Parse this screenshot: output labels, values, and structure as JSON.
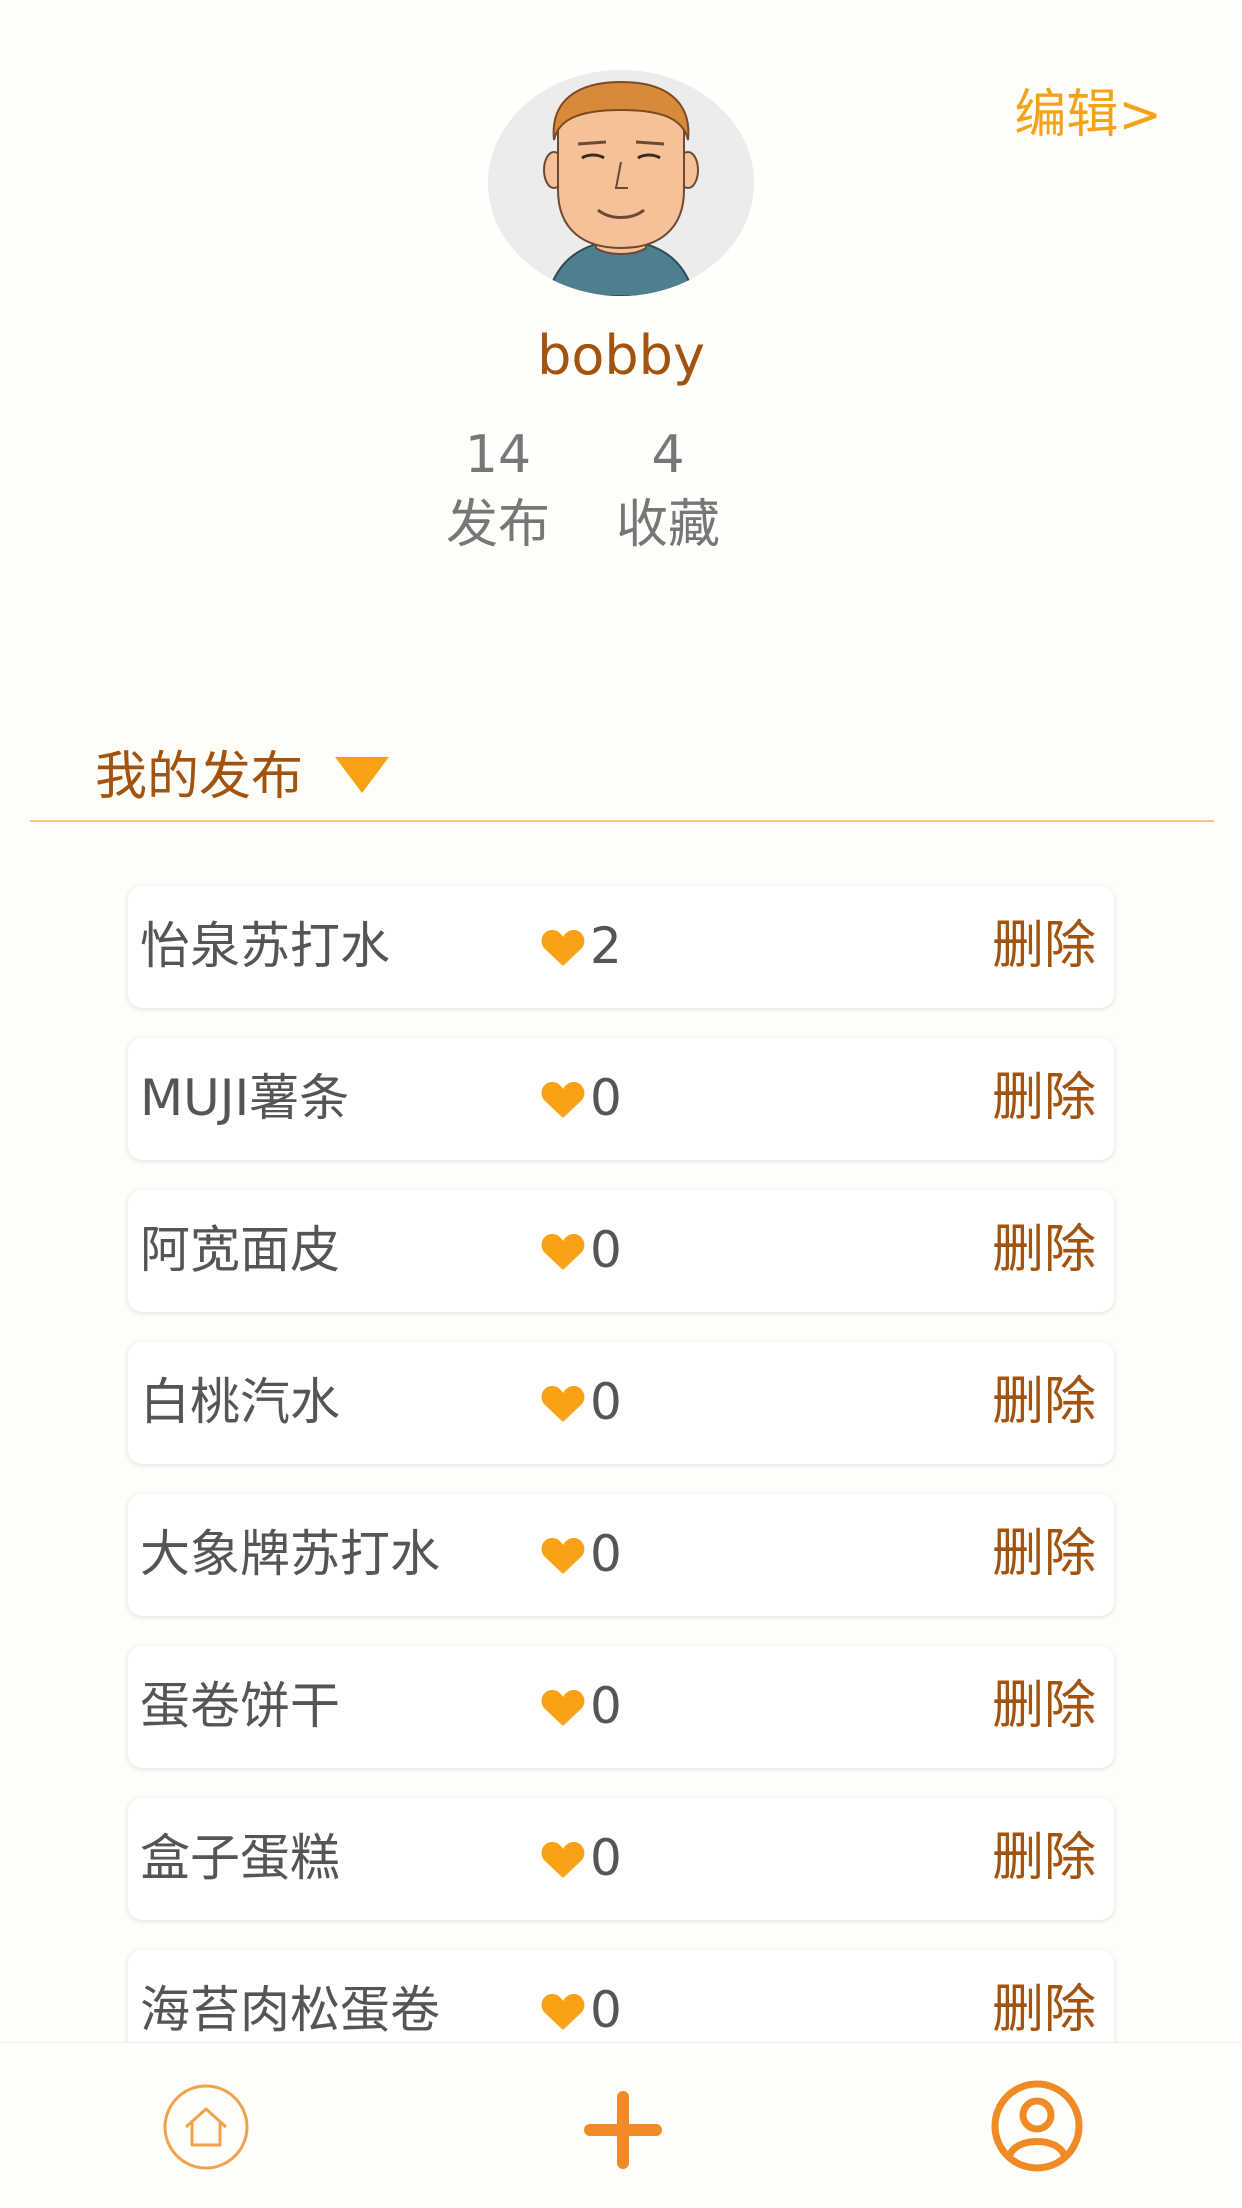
{
  "header": {
    "edit_label": "编辑>"
  },
  "profile": {
    "username": "bobby",
    "stats": [
      {
        "value": "14",
        "label": "发布"
      },
      {
        "value": "4",
        "label": "收藏"
      }
    ]
  },
  "section": {
    "title": "我的发布"
  },
  "posts": [
    {
      "title": "怡泉苏打水",
      "likes": "2",
      "delete_label": "删除"
    },
    {
      "title": "MUJI薯条",
      "likes": "0",
      "delete_label": "删除"
    },
    {
      "title": "阿宽面皮",
      "likes": "0",
      "delete_label": "删除"
    },
    {
      "title": "白桃汽水",
      "likes": "0",
      "delete_label": "删除"
    },
    {
      "title": "大象牌苏打水",
      "likes": "0",
      "delete_label": "删除"
    },
    {
      "title": "蛋卷饼干",
      "likes": "0",
      "delete_label": "删除"
    },
    {
      "title": "盒子蛋糕",
      "likes": "0",
      "delete_label": "删除"
    },
    {
      "title": "海苔肉松蛋卷",
      "likes": "0",
      "delete_label": "删除"
    }
  ],
  "tabbar": {
    "items": [
      {
        "icon": "home-icon"
      },
      {
        "icon": "plus-icon"
      },
      {
        "icon": "profile-icon"
      }
    ]
  },
  "colors": {
    "accent": "#f9a314",
    "brown": "#a2530f",
    "text": "#555555",
    "tab_orange": "#f08a24"
  }
}
